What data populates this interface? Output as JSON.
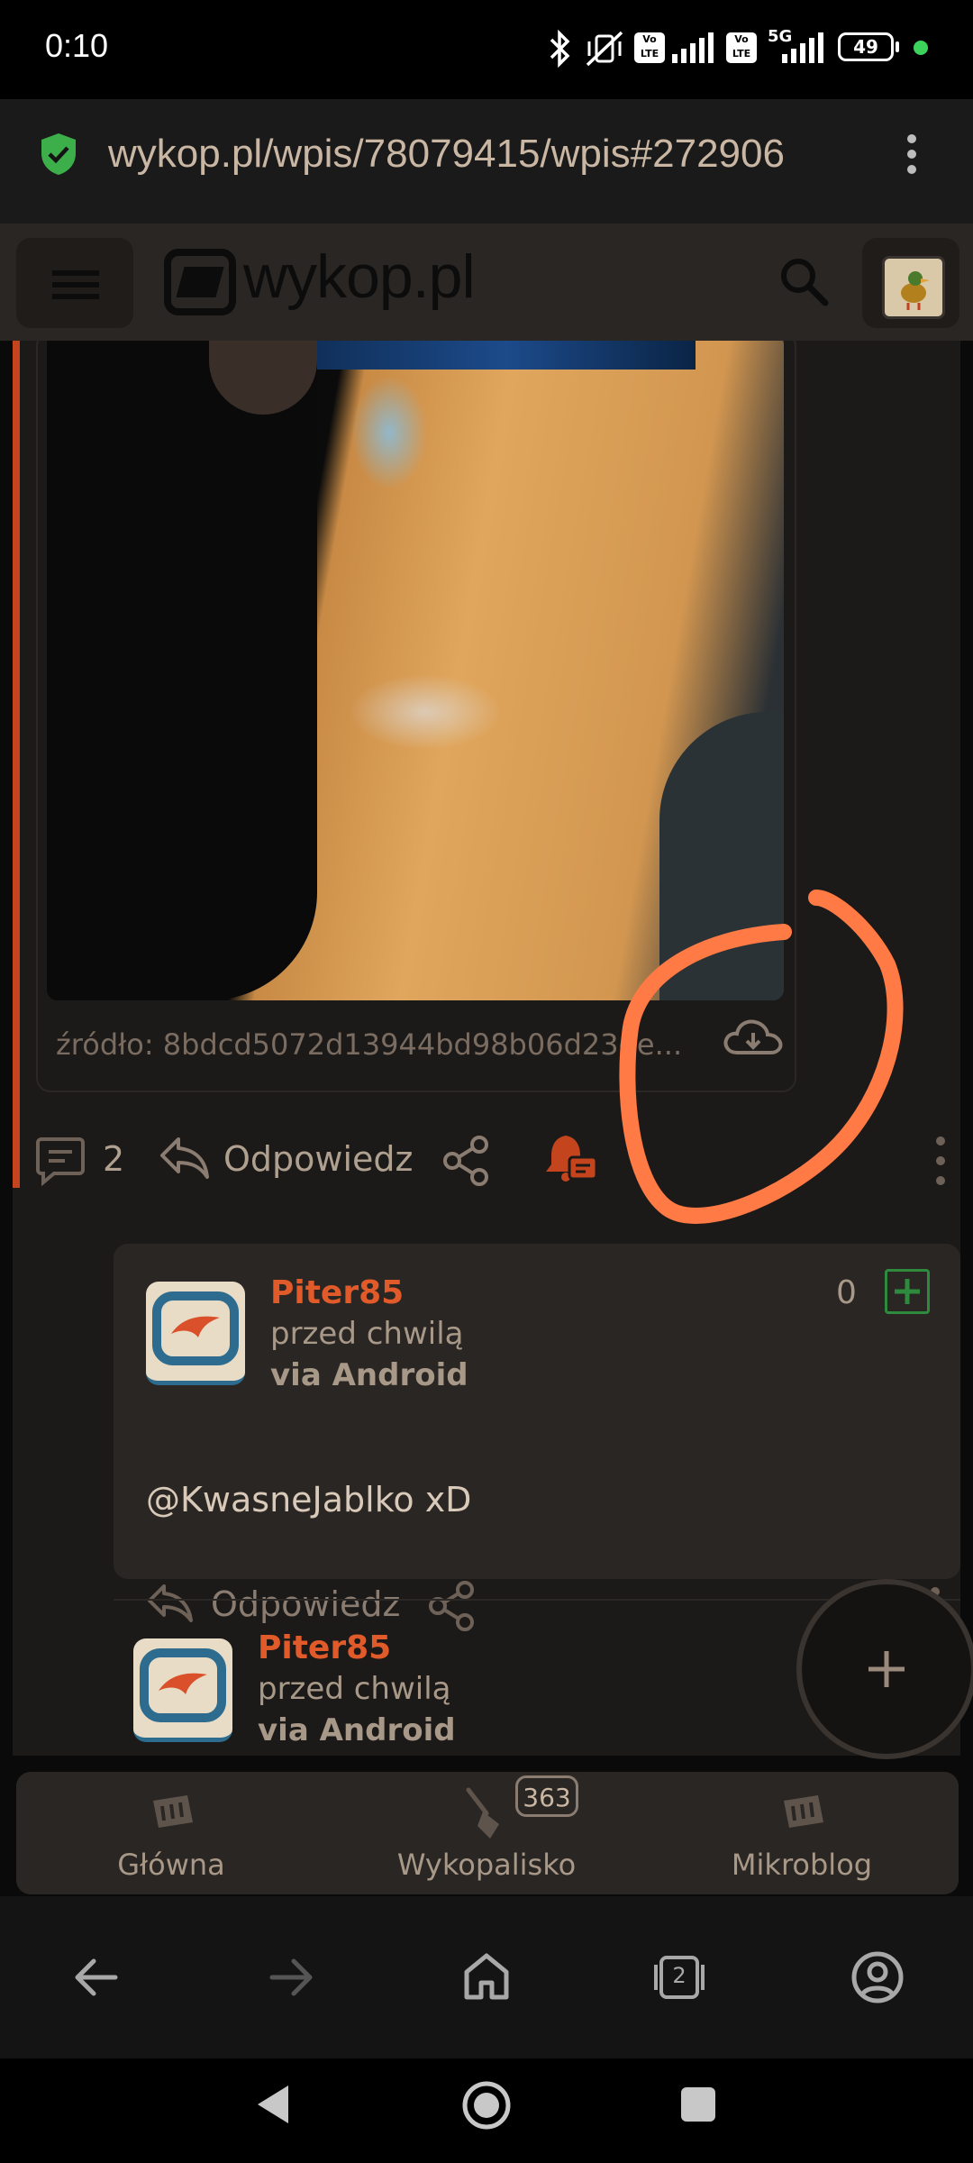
{
  "status": {
    "time": "0:10",
    "battery": "49",
    "network_5g": "5G",
    "volte_1": "Vo LTE",
    "volte_2": "Vo LTE"
  },
  "browser": {
    "url": "wykop.pl/wpis/78079415/wpis#272906"
  },
  "header": {
    "logo_text": "wykop.pl",
    "icons": [
      "hamburger-icon",
      "search-icon",
      "user-avatar"
    ]
  },
  "entry": {
    "source_label": "źródło: 8bdcd5072d13944bd98b06d23de...",
    "comment_count": "2",
    "reply_label": "Odpowiedz"
  },
  "comments": [
    {
      "username": "Piter85",
      "time": "przed chwilą",
      "via": "via Android",
      "votes": "0",
      "body": "@KwasneJablko xD",
      "reply_label": "Odpowiedz"
    },
    {
      "username": "Piter85",
      "time": "przed chwilą",
      "via": "via Android"
    }
  ],
  "tabbar": {
    "items": [
      {
        "label": "Główna"
      },
      {
        "label": "Wykopalisko",
        "badge": "363"
      },
      {
        "label": "Mikroblog"
      }
    ]
  },
  "browser_nav": {
    "tab_count": "2"
  },
  "colors": {
    "accent": "#c4441e",
    "username": "#e05a2a",
    "plus_green": "#2e8b3e",
    "annotation": "#ff7a45"
  }
}
